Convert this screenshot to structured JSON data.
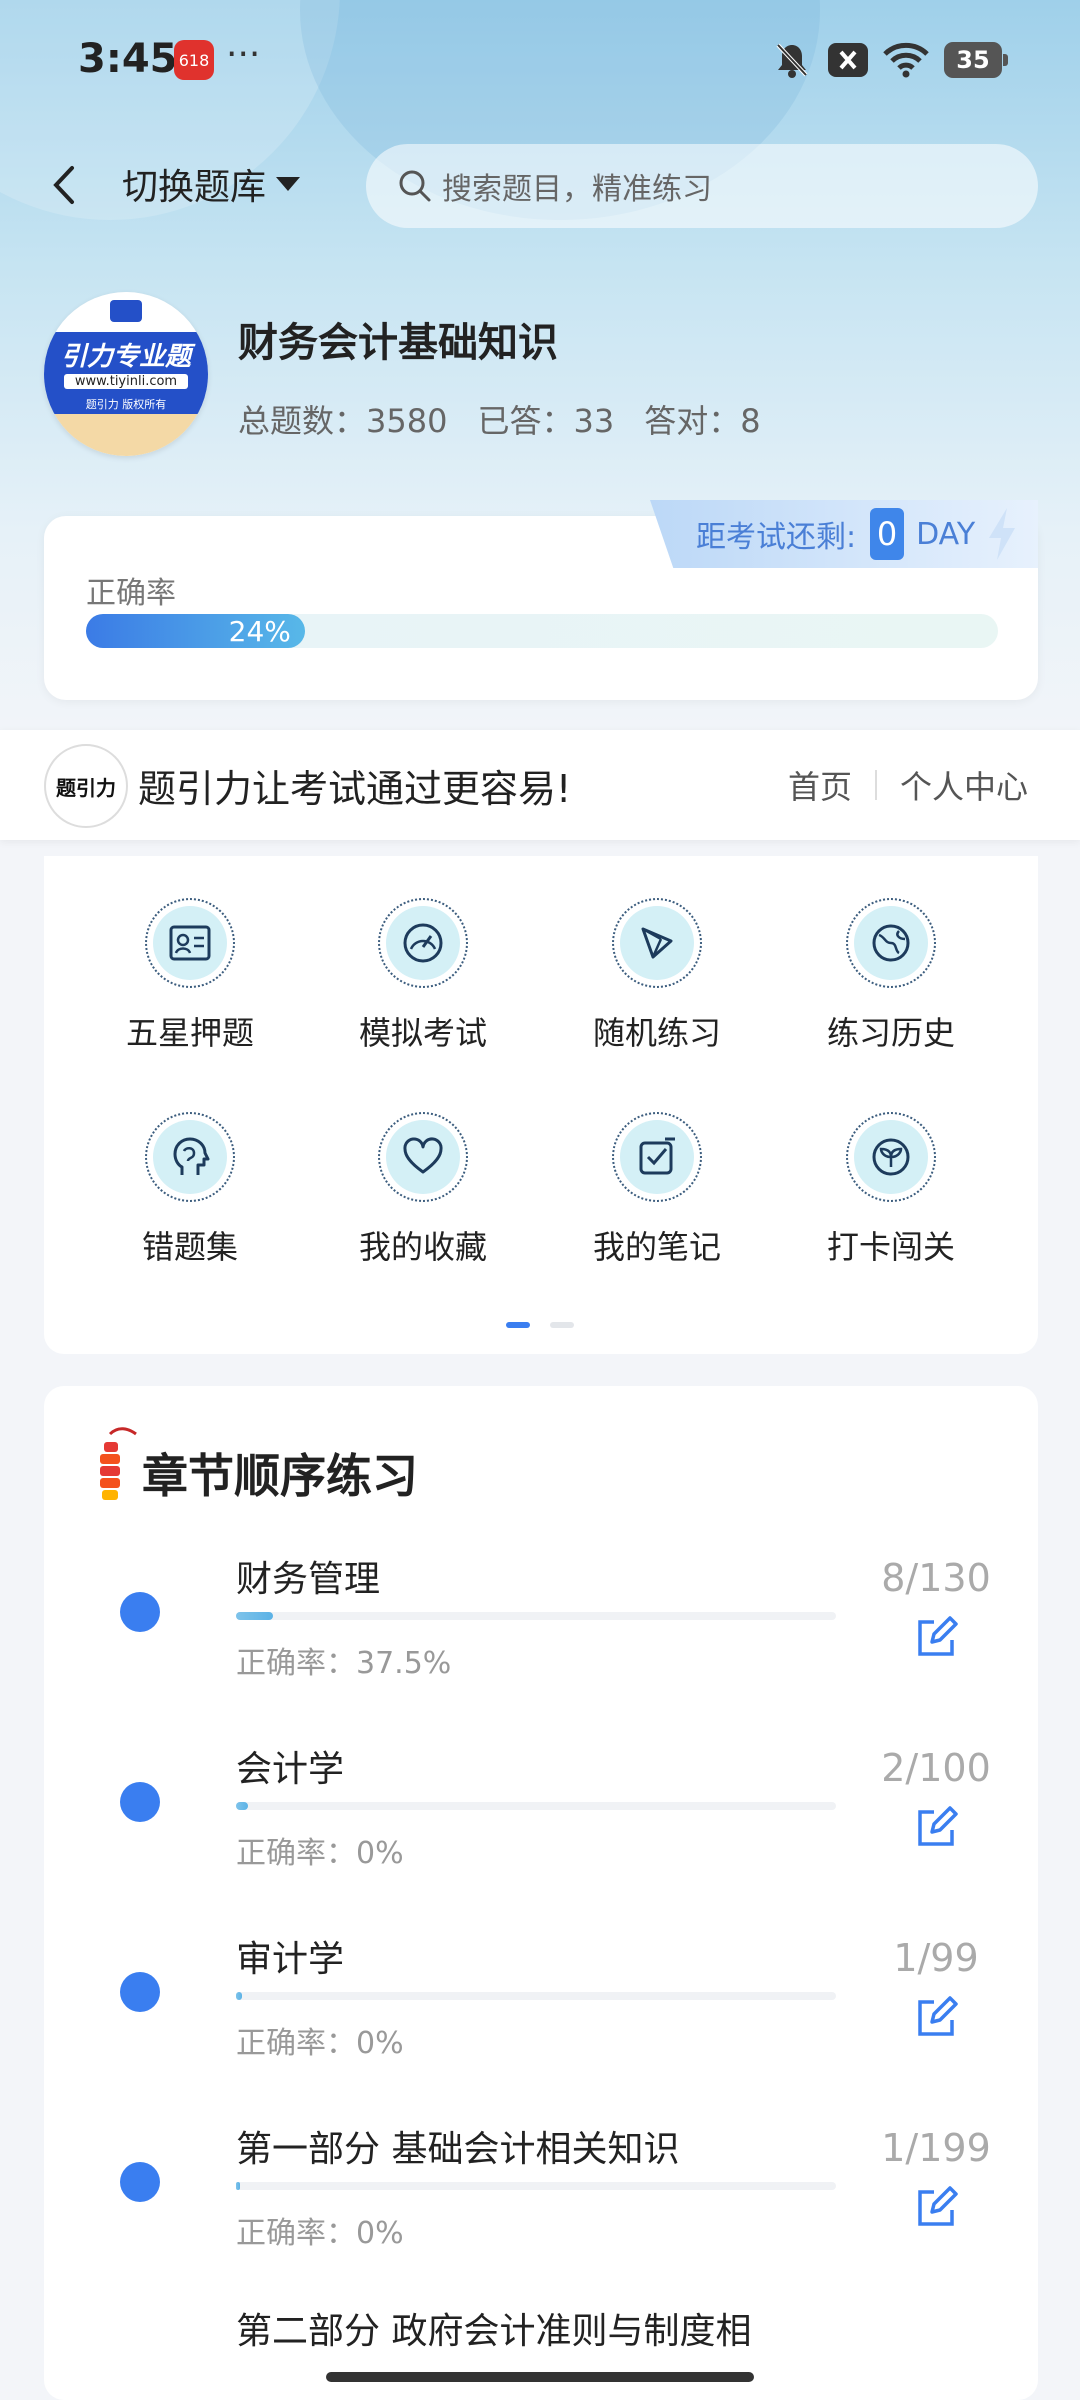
{
  "status_bar": {
    "time": "3:45",
    "app_badge": "618",
    "more": "···",
    "battery": "35"
  },
  "header": {
    "bank_switch_label": "切换题库",
    "search_placeholder": "搜索题目，精准练习"
  },
  "course": {
    "logo_top": "题引力",
    "logo_title": "引力专业题",
    "logo_url": "www.tiyinli.com",
    "logo_copyright": "题引力 版权所有",
    "title": "财务会计基础知识",
    "stats": {
      "total": "总题数：3580",
      "answered": "已答：33",
      "correct": "答对：8"
    }
  },
  "countdown": {
    "label": "距考试还剩:",
    "value": "0",
    "unit": "DAY"
  },
  "accuracy": {
    "label": "正确率",
    "value_text": "24%",
    "value": 0.24
  },
  "banner": {
    "logo_text": "题引力",
    "slogan": "题引力让考试通过更容易!",
    "nav_home": "首页",
    "nav_personal": "个人中心"
  },
  "features": [
    {
      "label": "五星押题",
      "icon": "id-card-icon"
    },
    {
      "label": "模拟考试",
      "icon": "speedometer-icon"
    },
    {
      "label": "随机练习",
      "icon": "random-shape-icon"
    },
    {
      "label": "练习历史",
      "icon": "globe-icon"
    },
    {
      "label": "错题集",
      "icon": "brain-head-icon"
    },
    {
      "label": "我的收藏",
      "icon": "heart-icon"
    },
    {
      "label": "我的笔记",
      "icon": "checkbox-icon"
    },
    {
      "label": "打卡闯关",
      "icon": "sprout-icon"
    }
  ],
  "chapters": {
    "title": "章节顺序练习",
    "items": [
      {
        "name": "财务管理",
        "accuracy": "正确率：37.5%",
        "count": "8/130",
        "progress": 0.062
      },
      {
        "name": "会计学",
        "accuracy": "正确率：0%",
        "count": "2/100",
        "progress": 0.02
      },
      {
        "name": "审计学",
        "accuracy": "正确率：0%",
        "count": "1/99",
        "progress": 0.01
      },
      {
        "name": "第一部分 基础会计相关知识",
        "accuracy": "正确率：0%",
        "count": "1/199",
        "progress": 0.005
      },
      {
        "name": "第二部分 政府会计准则与制度相",
        "accuracy": "",
        "count": "",
        "progress": 0
      }
    ]
  },
  "colors": {
    "accent": "#3a7ef0",
    "progress_start": "#3b7be6",
    "progress_end": "#58b8e8",
    "icon_bg": "#d4f0f6"
  }
}
